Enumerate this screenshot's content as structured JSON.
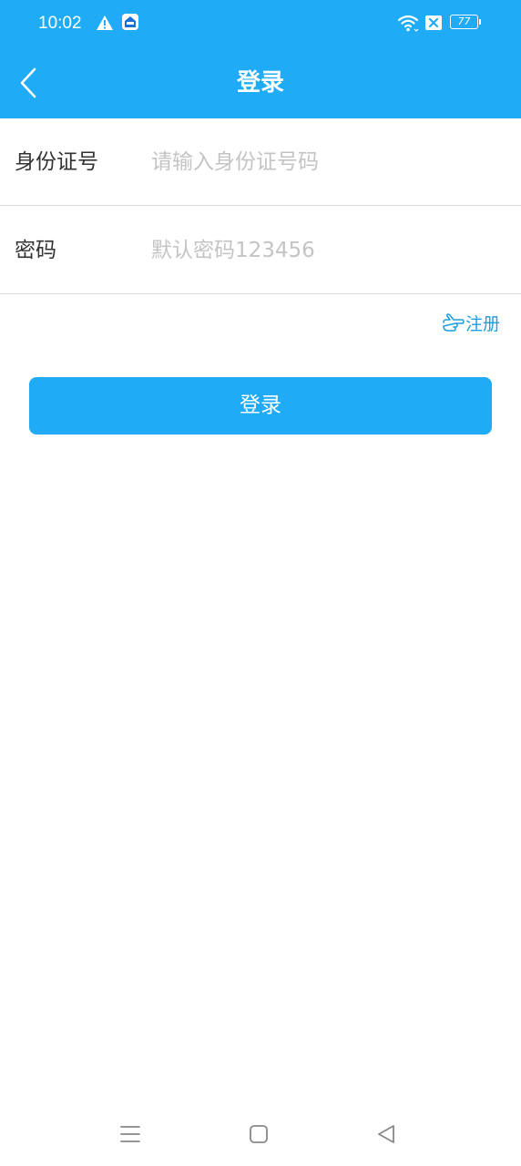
{
  "status_bar": {
    "time": "10:02",
    "battery": "77",
    "icons": [
      "warning-icon",
      "app-notification-icon",
      "wifi-icon",
      "sim-icon",
      "battery-icon"
    ]
  },
  "header": {
    "title": "登录",
    "back_icon": "chevron-left-icon",
    "background_color": "#1fabf6"
  },
  "form": {
    "id_label": "身份证号",
    "id_placeholder": "请输入身份证号码",
    "id_value": "",
    "password_label": "密码",
    "password_placeholder": "默认密码123456",
    "password_value": ""
  },
  "register": {
    "label": "注册",
    "icon": "pointing-hand-icon",
    "color": "#1a9fe0"
  },
  "login_button": {
    "label": "登录",
    "color": "#1fabf6"
  },
  "nav_bar": {
    "icons": [
      "menu-icon",
      "home-square-icon",
      "back-triangle-icon"
    ]
  }
}
